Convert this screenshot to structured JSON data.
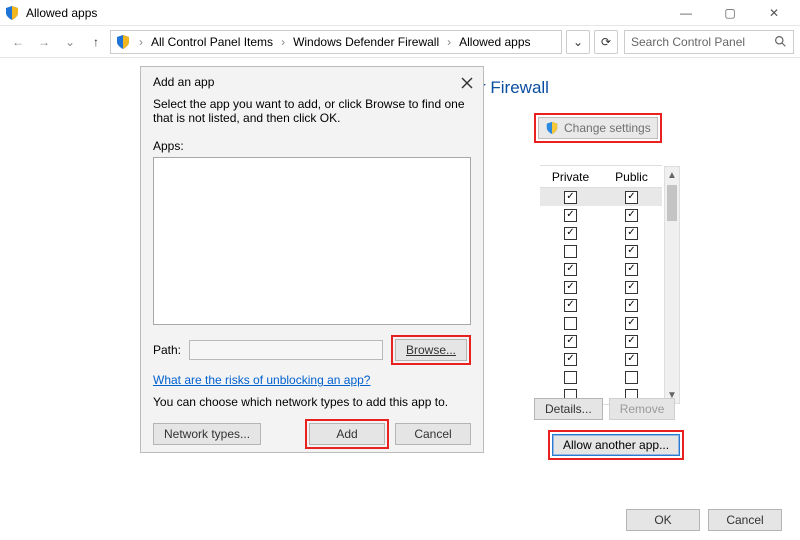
{
  "window": {
    "title": "Allowed apps"
  },
  "winbuttons": {
    "min": "—",
    "max": "▢",
    "close": "✕"
  },
  "breadcrumbs": {
    "items": [
      "All Control Panel Items",
      "Windows Defender Firewall",
      "Allowed apps"
    ],
    "sep": "›"
  },
  "toolbar": {
    "refresh": "⟳",
    "dropdown": "⌄"
  },
  "search": {
    "placeholder": "Search Control Panel"
  },
  "page": {
    "heading_fragment": "r Firewall",
    "change_settings": "Change settings",
    "headers": {
      "private": "Private",
      "public": "Public"
    },
    "details": "Details...",
    "remove": "Remove",
    "allow_another": "Allow another app..."
  },
  "rows": [
    {
      "priv": true,
      "pub": true,
      "sel": true
    },
    {
      "priv": true,
      "pub": true
    },
    {
      "priv": true,
      "pub": true
    },
    {
      "priv": false,
      "pub": true
    },
    {
      "priv": true,
      "pub": true
    },
    {
      "priv": true,
      "pub": true
    },
    {
      "priv": true,
      "pub": true
    },
    {
      "priv": false,
      "pub": true
    },
    {
      "priv": true,
      "pub": true
    },
    {
      "priv": true,
      "pub": true
    },
    {
      "priv": false,
      "pub": false
    },
    {
      "priv": false,
      "pub": false
    }
  ],
  "dialog": {
    "title": "Add an app",
    "instruction": "Select the app you want to add, or click Browse to find one that is not listed, and then click OK.",
    "apps_label": "Apps:",
    "path_label": "Path:",
    "path_value": "",
    "browse": "Browse...",
    "risk_link": "What are the risks of unblocking an app?",
    "network_note": "You can choose which network types to add this app to.",
    "network_types": "Network types...",
    "add": "Add",
    "cancel": "Cancel"
  },
  "footer": {
    "ok": "OK",
    "cancel": "Cancel"
  }
}
